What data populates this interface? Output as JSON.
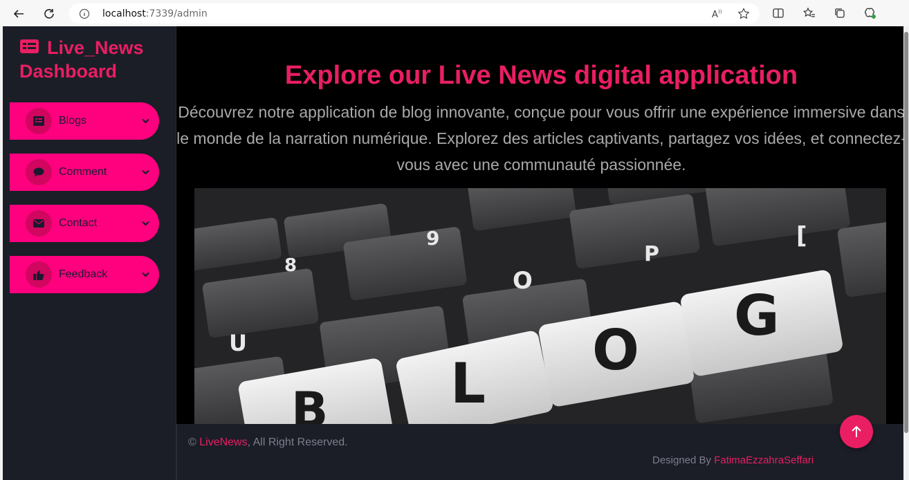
{
  "browser": {
    "url_host": "localhost",
    "url_path": ":7339/admin"
  },
  "sidebar": {
    "brand_line1": "Live_News",
    "brand_line2": "Dashboard",
    "items": [
      {
        "label": "Blogs",
        "icon": "list-icon"
      },
      {
        "label": "Comment",
        "icon": "comment-icon"
      },
      {
        "label": "Contact",
        "icon": "envelope-icon"
      },
      {
        "label": "Feedback",
        "icon": "thumbs-up-icon"
      }
    ]
  },
  "main": {
    "title": "Explore our Live News digital application",
    "text": "Découvrez notre application de blog innovante, conçue pour vous offrir une expérience immersive dans le monde de la narration numérique. Explorez des articles captivants, partagez vos idées, et connectez-vous avec une communauté passionnée."
  },
  "footer": {
    "copy_symbol": "©",
    "copy_brand": "LiveNews",
    "copy_rest": ", All Right Reserved.",
    "designed_prefix": "Designed By",
    "designer": "FatimaEzzahraSeffari"
  },
  "colors": {
    "accent": "#e91e63",
    "menu_bg": "#ff007f",
    "sidebar_bg": "#1b1e27"
  }
}
